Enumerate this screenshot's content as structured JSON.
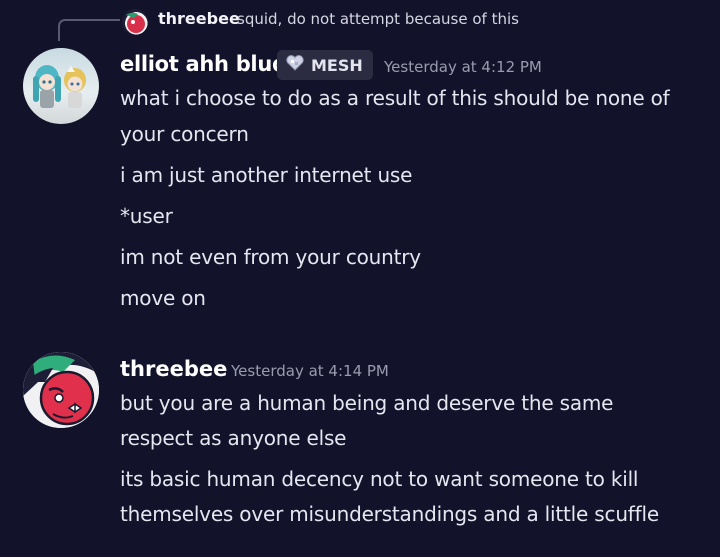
{
  "reply": {
    "author": "threebee",
    "text": "squid, do not attempt because of this"
  },
  "messages": [
    {
      "author": "elliot ahh blud",
      "tag": "MESH",
      "timestamp": "Yesterday at 4:12 PM",
      "lines": [
        "what i choose to do as a result of this should be none of",
        "your concern",
        "i am just another internet use",
        "*user",
        "im not even from your country",
        "move on"
      ]
    },
    {
      "author": "threebee",
      "timestamp": "Yesterday at 4:14 PM",
      "lines": [
        "but you are a human being and deserve the same",
        "respect as anyone else",
        "its basic human decency not to want someone to kill",
        "themselves over misunderstandings and a little scuffle"
      ]
    }
  ],
  "colors": {
    "background": "#12122a",
    "text": "#e6e6f0",
    "timestamp": "#9a9ab0",
    "tag_background": "#2b2b42"
  },
  "icons": {
    "tag_icon": "heart-badge-icon",
    "reply_line": "reply-spine"
  }
}
